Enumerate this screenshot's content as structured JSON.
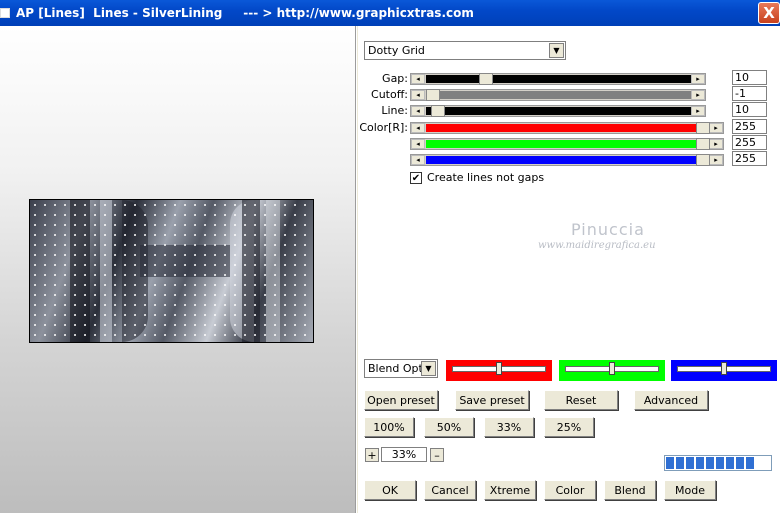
{
  "window": {
    "title": "AP [Lines]  Lines - SilverLining     --- > http://www.graphicxtras.com",
    "close_label": "X"
  },
  "preset": {
    "selected": "Dotty Grid"
  },
  "sliders": [
    {
      "label": "Gap:",
      "value": "10",
      "fill_color": "#000000",
      "level": 0.2
    },
    {
      "label": "Cutoff:",
      "value": "-1",
      "fill_color": "#808080",
      "level": 0.0
    },
    {
      "label": "Line:",
      "value": "10",
      "fill_color": "#000000",
      "level": 0.02
    },
    {
      "label": "Color[R]:",
      "value": "255",
      "fill_color": "#ff0000",
      "level": 1.0
    },
    {
      "label": "",
      "value": "255",
      "fill_color": "#00ff00",
      "level": 1.0
    },
    {
      "label": "",
      "value": "255",
      "fill_color": "#0000ff",
      "level": 1.0
    }
  ],
  "checkbox": {
    "label": "Create lines not gaps",
    "checked": true,
    "mark": "✔"
  },
  "watermark": {
    "name": "Pinuccia",
    "url": "www.maidiregrafica.eu"
  },
  "blend": {
    "selected": "Blend Options"
  },
  "color_sliders": [
    {
      "color": "#ff0000",
      "level": 0.5
    },
    {
      "color": "#00ff00",
      "level": 0.5
    },
    {
      "color": "#0000ff",
      "level": 0.5
    }
  ],
  "buttons_row1": [
    "Open preset",
    "Save preset",
    "Reset",
    "Advanced"
  ],
  "zoom_buttons": [
    "100%",
    "50%",
    "33%",
    "25%"
  ],
  "zoom": {
    "plus": "+",
    "value": "33%",
    "minus": "–"
  },
  "bottom_buttons": [
    "OK",
    "Cancel",
    "Xtreme",
    "Color",
    "Blend",
    "Mode"
  ],
  "progress": {
    "segments": 9
  }
}
